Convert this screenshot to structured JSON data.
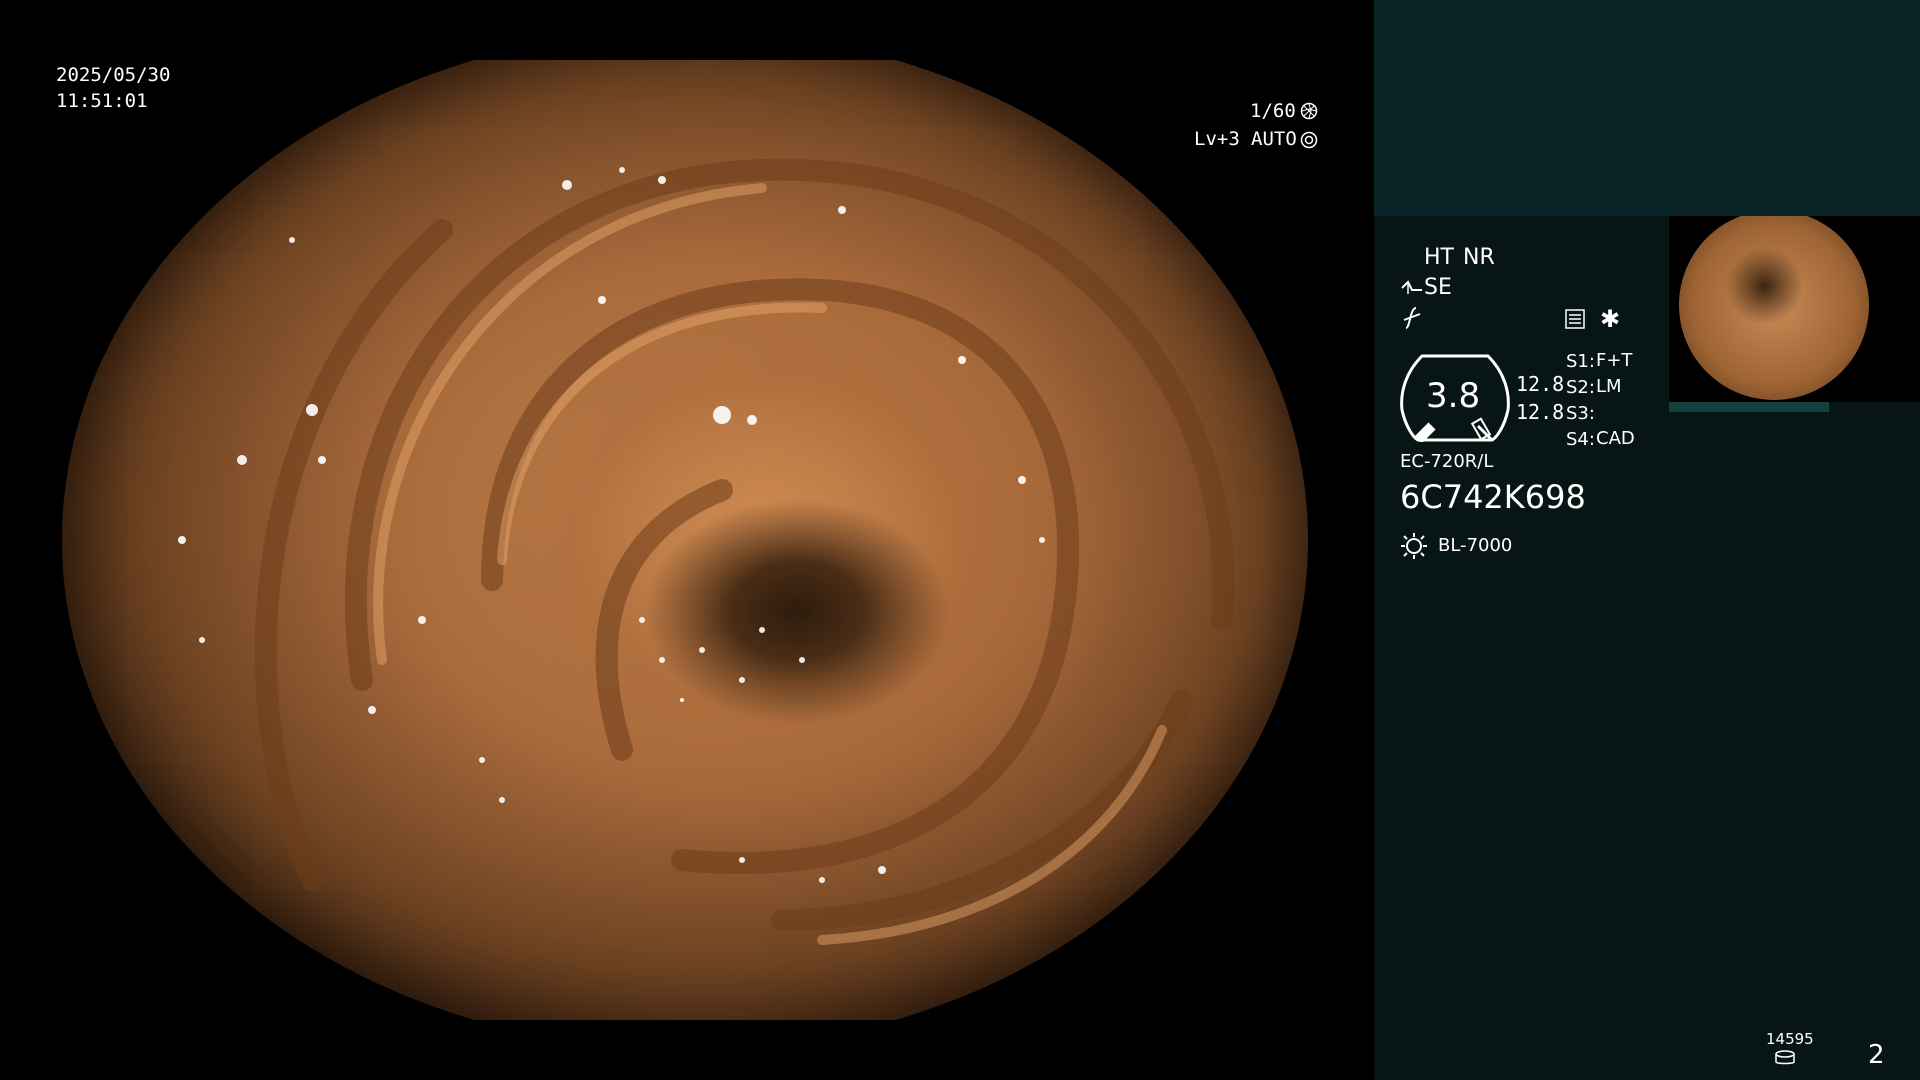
{
  "overlay": {
    "date": "2025/05/30",
    "time": "11:51:01",
    "shutter": "1/60",
    "level": "Lv+3",
    "auto": "AUTO"
  },
  "panel": {
    "ht": "HT",
    "nr": "NR",
    "se": "SE",
    "gauge_value": "3.8",
    "value_a": "12.8",
    "value_b": "12.8",
    "s1_label": "S1:",
    "s1_value": "F+T",
    "s2_label": "S2:",
    "s2_value": "LM",
    "s3_label": "S3:",
    "s3_value": "",
    "s4_label": "S4:",
    "s4_value": "CAD",
    "scope_model": "EC-720R/L",
    "serial": "6C742K698",
    "light_source": "BL-7000",
    "counter": "14595",
    "page_number": "2"
  },
  "icons": {
    "shutter": "aperture-icon",
    "auto": "iris-icon",
    "scope": "scope-mode-icon",
    "flash": "flash-off-icon",
    "memo": "memo-icon",
    "star": "asterisk-icon",
    "light": "light-source-icon",
    "storage": "storage-icon"
  },
  "colors": {
    "accent": "#ff9c1e",
    "panel_bg": "#071514",
    "panel_top": "#0a2327"
  }
}
